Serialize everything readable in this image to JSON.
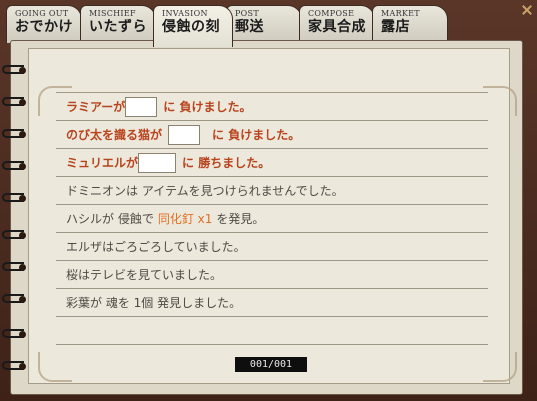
{
  "tabs": [
    {
      "sub": "GOING OUT",
      "label": "おでかけ",
      "active": false
    },
    {
      "sub": "MISCHIEF",
      "label": "いたずら",
      "active": false
    },
    {
      "sub": "INVASION",
      "label": "侵蝕の刻",
      "active": true
    },
    {
      "sub": "POST",
      "label": "郵送",
      "active": false
    },
    {
      "sub": "COMPOSE",
      "label": "家具合成",
      "active": false
    },
    {
      "sub": "MARKET",
      "label": "露店",
      "active": false
    }
  ],
  "log": {
    "battles": [
      {
        "name": "ラミアーが",
        "result": "に 負けました。"
      },
      {
        "name": "のび太を識る猫が",
        "result": "に 負けました。"
      },
      {
        "name": "ミュリエルが",
        "result": "に 勝ちました。"
      }
    ],
    "line4": "ドミニオンは アイテムを見つけられませんでした。",
    "line5_before": "ハシルが 侵蝕で",
    "line5_item": "同化釘 x1",
    "line5_after": "を発見。",
    "line6": "エルザはごろごろしていました。",
    "line7": "桜はテレビを見ていました。",
    "line8": "彩葉が 魂を 1個 発見しました。"
  },
  "pager": "001/001",
  "colors": {
    "battle_text": "#b8431c",
    "item_text": "#e07024",
    "normal_text": "#4e4a44"
  }
}
